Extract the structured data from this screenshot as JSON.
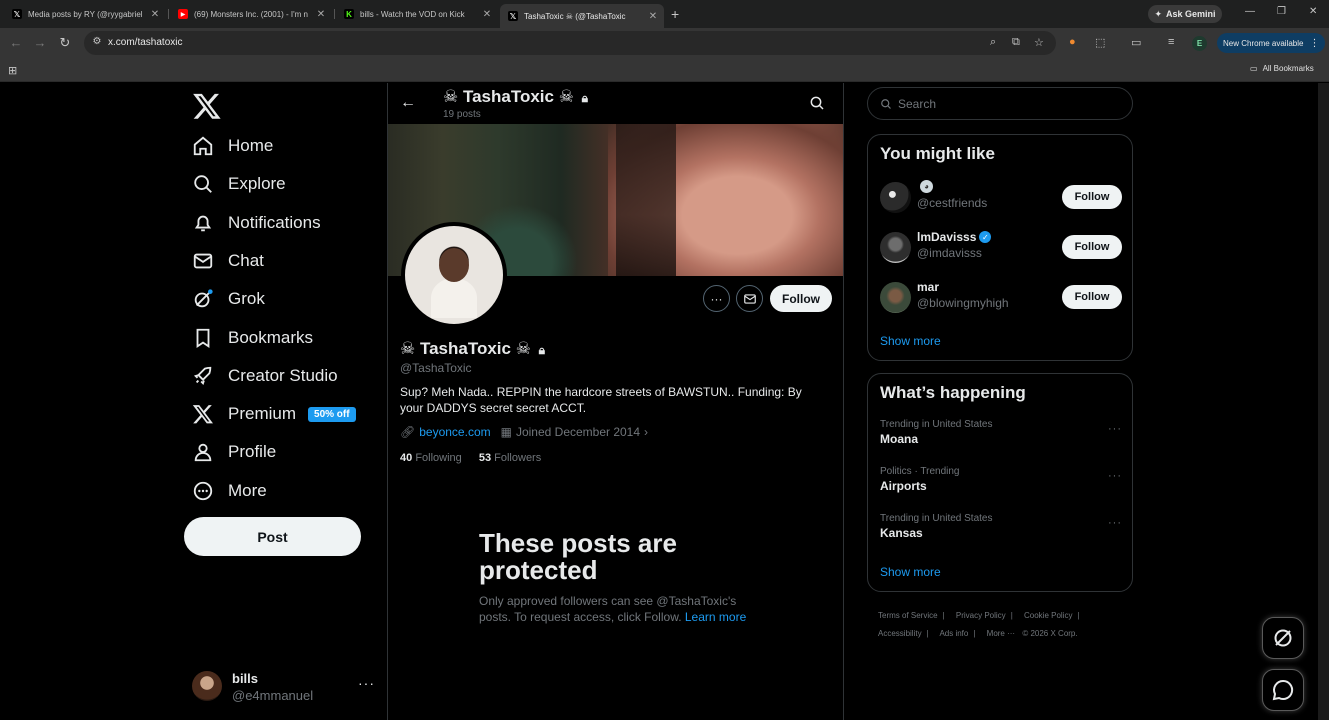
{
  "browser": {
    "tabs": [
      {
        "title": "Media posts by RY (@ryygabriel",
        "favicon": "x-icon",
        "color": "#000000"
      },
      {
        "title": "(69) Monsters Inc. (2001) - I'm n",
        "favicon": "youtube-icon",
        "color": "#ff0000"
      },
      {
        "title": "bills - Watch the VOD on Kick",
        "favicon": "kick-icon",
        "color": "#53fc18"
      },
      {
        "title": "TashaToxic ☠ (@TashaToxic",
        "favicon": "x-icon",
        "color": "#000000"
      }
    ],
    "active_tab": 3,
    "ask_gemini": "Ask Gemini",
    "url": "x.com/tashatoxic",
    "profile_initial": "E",
    "new_chrome": "New Chrome available",
    "all_bookmarks": "All Bookmarks"
  },
  "nav": {
    "items": [
      {
        "label": "Home",
        "icon": "home-icon"
      },
      {
        "label": "Explore",
        "icon": "search-icon"
      },
      {
        "label": "Notifications",
        "icon": "bell-icon"
      },
      {
        "label": "Chat",
        "icon": "mail-icon"
      },
      {
        "label": "Grok",
        "icon": "grok-icon"
      },
      {
        "label": "Bookmarks",
        "icon": "bookmark-icon"
      },
      {
        "label": "Creator Studio",
        "icon": "rocket-icon"
      },
      {
        "label": "Premium",
        "icon": "x-icon"
      },
      {
        "label": "Profile",
        "icon": "person-icon"
      },
      {
        "label": "More",
        "icon": "more-circle-icon"
      }
    ],
    "premium_badge": "50% off",
    "post_button": "Post"
  },
  "account": {
    "name": "bills",
    "handle": "@e4mmanuel"
  },
  "header": {
    "name": "☠ TashaToxic ☠",
    "posts": "19 posts"
  },
  "profile": {
    "name": "☠ TashaToxic ☠",
    "handle": "@TashaToxic",
    "bio": "Sup? Meh Nada.. REPPIN the hardcore streets of BAWSTUN.. Funding: By your DADDYS secret secret ACCT.",
    "link": "beyonce.com",
    "joined": "Joined December 2014",
    "following_count": "40",
    "following_label": "Following",
    "followers_count": "53",
    "followers_label": "Followers",
    "follow_button": "Follow"
  },
  "protected": {
    "title": "These posts are protected",
    "body": "Only approved followers can see @TashaToxic's posts. To request access, click Follow.",
    "learn_more": "Learn more"
  },
  "sidebar": {
    "search_placeholder": "Search",
    "who_to_follow": {
      "title": "You might like",
      "users": [
        {
          "name": "",
          "handle": "@cestfriends",
          "verified": false,
          "follow": "Follow"
        },
        {
          "name": "lmDavisss",
          "handle": "@imdavisss",
          "verified": true,
          "follow": "Follow"
        },
        {
          "name": "mar",
          "handle": "@blowingmyhigh",
          "verified": false,
          "follow": "Follow"
        }
      ],
      "show_more": "Show more"
    },
    "trends": {
      "title": "What’s happening",
      "items": [
        {
          "context": "Trending in United States",
          "topic": "Moana"
        },
        {
          "context": "Politics · Trending",
          "topic": "Airports"
        },
        {
          "context": "Trending in United States",
          "topic": "Kansas"
        }
      ],
      "show_more": "Show more"
    },
    "footer": {
      "links": [
        "Terms of Service",
        "Privacy Policy",
        "Cookie Policy",
        "Accessibility",
        "Ads info",
        "More ···"
      ],
      "copyright": "© 2026 X Corp."
    }
  }
}
